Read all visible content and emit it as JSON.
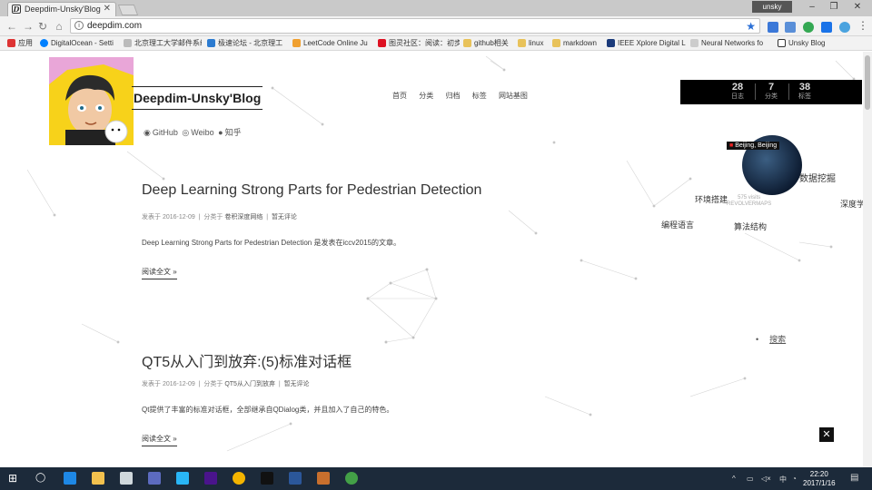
{
  "browser": {
    "tab_title": "Deepdim-Unsky'Blog",
    "url": "deepdim.com",
    "user": "unsky",
    "bookmarks": [
      "应用",
      "DigitalOcean - Setti",
      "北京理工大学邮件系统",
      "极速论坛 - 北京理工",
      "LeetCode Online Ju",
      "图灵社区：阅读：初步",
      "github相关",
      "linux",
      "markdown",
      "IEEE Xplore Digital L",
      "Neural Networks fo",
      "Unsky Blog"
    ]
  },
  "site": {
    "title": "Deepdim-Unsky'Blog",
    "social": {
      "github": "GitHub",
      "weibo": "Weibo",
      "zhihu": "知乎"
    },
    "nav": [
      "首页",
      "分类",
      "归档",
      "标签",
      "网站基图"
    ],
    "stats": [
      {
        "n": "28",
        "l": "日志"
      },
      {
        "n": "7",
        "l": "分类"
      },
      {
        "n": "38",
        "l": "标签"
      }
    ],
    "location": "Beijing, Beijing",
    "visits": "575 visits",
    "visits_brand": "REVOLVERMAPS",
    "tags": [
      "数据挖掘",
      "环境搭建",
      "深度学",
      "编程语言",
      "算法结构"
    ],
    "search_label": "搜索",
    "read_more": "阅读全文 »"
  },
  "posts": [
    {
      "title": "Deep Learning Strong Parts for Pedestrian Detection",
      "date": "发表于 2016-12-09",
      "category_prefix": "分类于",
      "category": "卷积深度网络",
      "comments": "暂无评论",
      "excerpt": "Deep Learning Strong Parts for Pedestrian Detection 是发表在iccv2015的文章。"
    },
    {
      "title": "QT5从入门到放弃:(5)标准对话框",
      "date": "发表于 2016-12-09",
      "category_prefix": "分类于",
      "category": "QT5从入门到放弃",
      "comments": "暂无评论",
      "excerpt": "Qt提供了丰富的标准对话框，全部继承自QDialog类，并且加入了自己的特色。"
    }
  ],
  "taskbar": {
    "time": "22:20",
    "date": "2017/1/16"
  },
  "colors": {
    "globe": "#0e1d33",
    "stats_bg": "#000000",
    "taskbar": "#1c2a3a"
  }
}
